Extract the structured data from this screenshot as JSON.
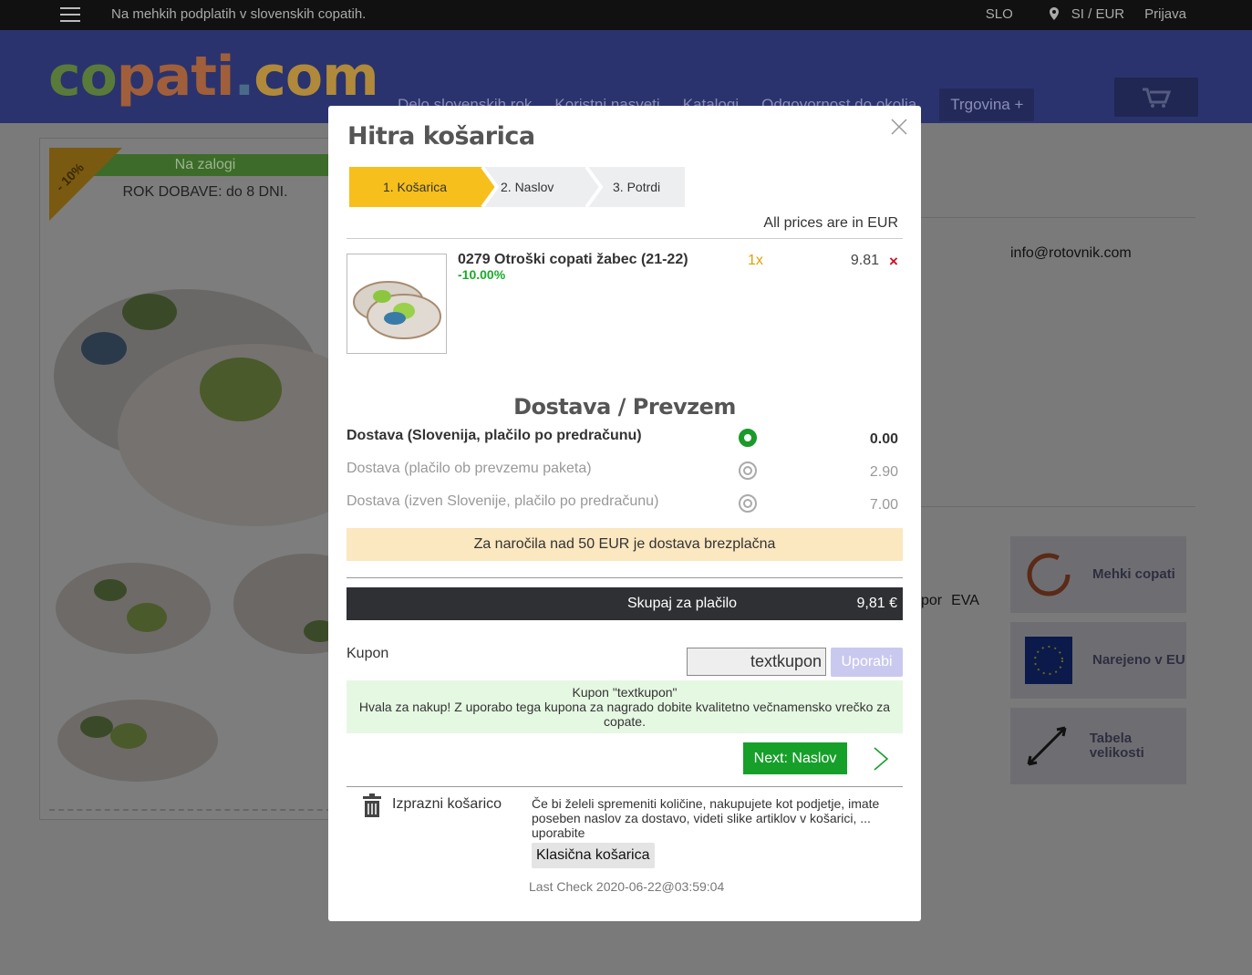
{
  "topbar": {
    "tagline": "Na mehkih podplatih v slovenskih copatih.",
    "lang": "SLO",
    "region": "SI / EUR",
    "login": "Prijava"
  },
  "header": {
    "logo": {
      "part1": "co",
      "part2": "pati",
      "part3": ".",
      "part4": "com"
    },
    "nav": [
      "Delo slovenskih rok",
      "Koristni nasveti",
      "Katalogi",
      "Odgovornost do okolja"
    ],
    "shop": "Trgovina +"
  },
  "product": {
    "discount": "- 10%",
    "stock": "Na zalogi",
    "lead_time": "ROK DOBAVE: do 8 DNI."
  },
  "sidebar": {
    "email": "info@rotovnik.com",
    "materials": [
      "por",
      "EVA"
    ],
    "boxes": [
      {
        "label": "Mehki copati"
      },
      {
        "label": "Narejeno v EU"
      },
      {
        "label": "Tabela velikosti"
      }
    ]
  },
  "cart": {
    "title": "Hitra košarica",
    "steps": [
      "1. Košarica",
      "2. Naslov",
      "3. Potrdi"
    ],
    "currency_note": "All prices are in EUR",
    "item": {
      "name": "0279 Otroški copati žabec (21-22)",
      "discount": "-10.00%",
      "qty": "1x",
      "price": "9.81",
      "remove": "×"
    },
    "shipping": {
      "title": "Dostava / Prevzem",
      "options": [
        {
          "label": "Dostava (Slovenija, plačilo po predračunu)",
          "price": "0.00",
          "selected": true
        },
        {
          "label": "Dostava (plačilo ob prevzemu paketa)",
          "price": "2.90",
          "selected": false
        },
        {
          "label": "Dostava (izven Slovenije, plačilo po predračunu)",
          "price": "7.00",
          "selected": false
        }
      ],
      "free_note": "Za naročila nad 50 EUR je dostava brezplačna"
    },
    "total": {
      "label": "Skupaj za plačilo",
      "value": "9,81 €"
    },
    "coupon": {
      "label": "Kupon",
      "value": "textkupon",
      "button": "Uporabi",
      "msg_title": "Kupon \"textkupon\"",
      "msg_body": "Hvala za nakup! Z uporabo tega kupona za nagrado dobite kvalitetno večnamensko vrečko za copate."
    },
    "next_button": "Next: Naslov",
    "empty_cart": "Izprazni košarico",
    "help_text": "Če bi želeli spremeniti količine, nakupujete kot podjetje, imate poseben naslov za dostavo, videti slike artiklov v košarici, ... uporabite",
    "classic_button": "Klasična košarica",
    "last_check": "Last Check 2020-06-22@03:59:04"
  },
  "colors": {
    "accent_yellow": "#f7bf1b",
    "success_green": "#16a02a",
    "remove_red": "#d0102a",
    "header_blue": "#2a336e"
  }
}
